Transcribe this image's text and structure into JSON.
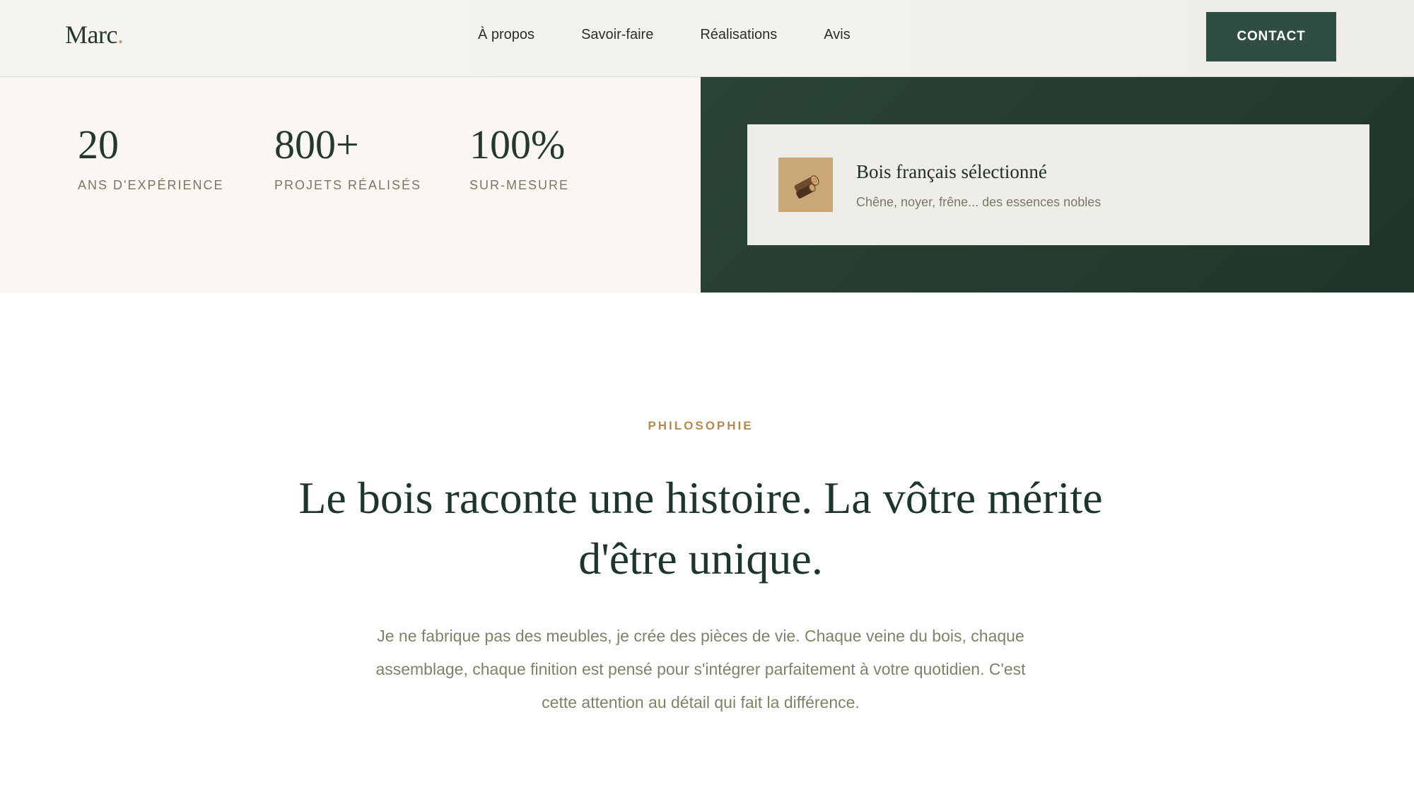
{
  "header": {
    "logo_text": "Marc",
    "logo_dot": ".",
    "nav": [
      {
        "label": "À propos"
      },
      {
        "label": "Savoir-faire"
      },
      {
        "label": "Réalisations"
      },
      {
        "label": "Avis"
      }
    ],
    "contact_label": "CONTACT"
  },
  "stats": [
    {
      "value": "20",
      "label": "ANS D'EXPÉRIENCE"
    },
    {
      "value": "800+",
      "label": "PROJETS RÉALISÉS"
    },
    {
      "value": "100%",
      "label": "SUR-MESURE"
    }
  ],
  "feature": {
    "icon": "wood-log-icon",
    "title": "Bois français sélectionné",
    "subtitle": "Chêne, noyer, frêne... des essences nobles"
  },
  "philosophy": {
    "kicker": "PHILOSOPHIE",
    "title": "Le bois raconte une histoire. La vôtre mérite d'être unique.",
    "body": "Je ne fabrique pas des meubles, je crée des pièces de vie. Chaque veine du bois, chaque assemblage, chaque finition est pensé pour s'intégrer parfaitement à votre quotidien. C'est cette attention au détail qui fait la différence."
  },
  "colors": {
    "brand_green": "#2f4d40",
    "accent_gold": "#b58a4f",
    "cream": "#faf7f2"
  }
}
